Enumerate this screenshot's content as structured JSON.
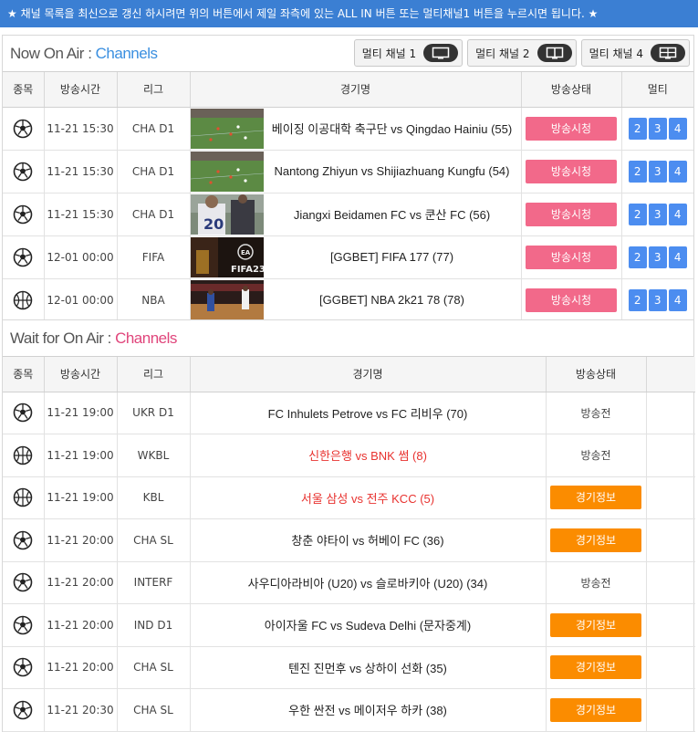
{
  "notice": "★ 채널 목록을 최신으로 갱신 하시려면 위의 버튼에서 제일 좌측에 있는 ALL IN 버튼 또는 멀티채널1 버튼을 누르시면 됩니다. ★",
  "live": {
    "title_main": "Now On Air",
    "title_colon": " : ",
    "title_channels": "Channels",
    "multi_buttons": [
      {
        "label": "멀티 채널 1",
        "icon": "single-screen-icon"
      },
      {
        "label": "멀티 채널 2",
        "icon": "dual-screen-icon"
      },
      {
        "label": "멀티 채널 4",
        "icon": "quad-screen-icon"
      }
    ],
    "headers": [
      "종목",
      "방송시간",
      "리그",
      "경기명",
      "방송상태",
      "멀티"
    ],
    "rows": [
      {
        "sport": "soccer",
        "time": "11-21 15:30",
        "league": "CHA D1",
        "match": "베이징 이공대학 축구단 vs Qingdao Hainiu (55)",
        "status": "방송시청",
        "thumb": "soccer-pitch-thumbnail"
      },
      {
        "sport": "soccer",
        "time": "11-21 15:30",
        "league": "CHA D1",
        "match": "Nantong Zhiyun vs Shijiazhuang Kungfu (54)",
        "status": "방송시청",
        "thumb": "soccer-pitch-thumbnail"
      },
      {
        "sport": "soccer",
        "time": "11-21 15:30",
        "league": "CHA D1",
        "match": "Jiangxi Beidamen FC vs 쿤산 FC (56)",
        "status": "방송시청",
        "thumb": "player-closeup-thumbnail"
      },
      {
        "sport": "soccer",
        "time": "12-01 00:00",
        "league": "FIFA",
        "match": "[GGBET] FIFA 177 (77)",
        "status": "방송시청",
        "thumb": "fifa23-thumbnail"
      },
      {
        "sport": "basketball",
        "time": "12-01 00:00",
        "league": "NBA",
        "match": "[GGBET] NBA 2k21 78 (78)",
        "status": "방송시청",
        "thumb": "nba-court-thumbnail"
      }
    ],
    "multi_numbers": [
      "2",
      "3",
      "4"
    ]
  },
  "wait": {
    "title_main": "Wait for On Air",
    "title_colon": " : ",
    "title_channels": "Channels",
    "headers": [
      "종목",
      "방송시간",
      "리그",
      "경기명",
      "방송상태",
      ""
    ],
    "rows": [
      {
        "sport": "soccer",
        "time": "11-21 19:00",
        "league": "UKR D1",
        "match": "FC Inhulets Petrove vs FC 리비우 (70)",
        "status": "방송전",
        "kind": "pending",
        "red": false
      },
      {
        "sport": "basketball",
        "time": "11-21 19:00",
        "league": "WKBL",
        "match": "신한은행 vs BNK 썸 (8)",
        "status": "방송전",
        "kind": "pending",
        "red": true
      },
      {
        "sport": "basketball",
        "time": "11-21 19:00",
        "league": "KBL",
        "match": "서울 삼성 vs 전주 KCC (5)",
        "status": "경기정보",
        "kind": "info",
        "red": true
      },
      {
        "sport": "soccer",
        "time": "11-21 20:00",
        "league": "CHA SL",
        "match": "창춘 야타이 vs 허베이 FC (36)",
        "status": "경기정보",
        "kind": "info",
        "red": false
      },
      {
        "sport": "soccer",
        "time": "11-21 20:00",
        "league": "INTERF",
        "match": "사우디아라비아 (U20) vs 슬로바키아 (U20) (34)",
        "status": "방송전",
        "kind": "pending",
        "red": false
      },
      {
        "sport": "soccer",
        "time": "11-21 20:00",
        "league": "IND D1",
        "match": "아이자울 FC vs Sudeva Delhi (문자중계)",
        "status": "경기정보",
        "kind": "info",
        "red": false
      },
      {
        "sport": "soccer",
        "time": "11-21 20:00",
        "league": "CHA SL",
        "match": "텐진 진먼후 vs 상하이 선화 (35)",
        "status": "경기정보",
        "kind": "info",
        "red": false
      },
      {
        "sport": "soccer",
        "time": "11-21 20:30",
        "league": "CHA SL",
        "match": "우한 싼전 vs 메이저우 하카 (38)",
        "status": "경기정보",
        "kind": "info",
        "red": false
      }
    ]
  },
  "colors": {
    "notice_bg": "#3b7fd3",
    "watch_btn": "#f2698a",
    "info_btn": "#fb8c00",
    "multi_num": "#4c8df0",
    "channels_blue": "#3a8fe0",
    "channels_pink": "#e0457b",
    "red_match": "#e8322f"
  }
}
